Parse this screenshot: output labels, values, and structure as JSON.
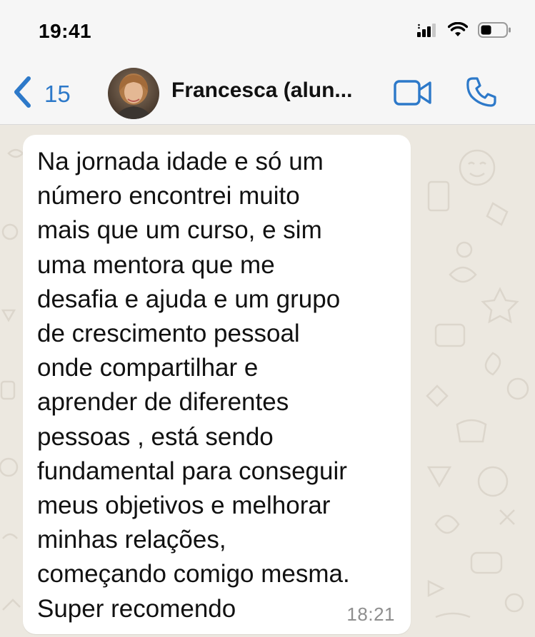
{
  "status_bar": {
    "time": "19:41",
    "icons": [
      "signal-icon",
      "wifi-icon",
      "battery-icon"
    ]
  },
  "header": {
    "back_count": "15",
    "contact_name": "Francesca (alun...",
    "icons": [
      "chevron-left-icon",
      "video-call-icon",
      "phone-icon"
    ],
    "accent_color": "#2d79c9"
  },
  "chat": {
    "message": {
      "text": "Na jornada idade e só um\nnúmero encontrei muito\nmais que um curso, e  sim\numa  mentora que me\ndesafia e ajuda e um grupo\nde crescimento pessoal\nonde compartilhar e\naprender de diferentes\npessoas , está sendo\nfundamental para conseguir\nmeus objetivos e melhorar\nminhas relações,\ncomeçando comigo mesma.\nSuper recomendo",
      "time": "18:21"
    },
    "wallpaper_color": "#ece8e0"
  }
}
